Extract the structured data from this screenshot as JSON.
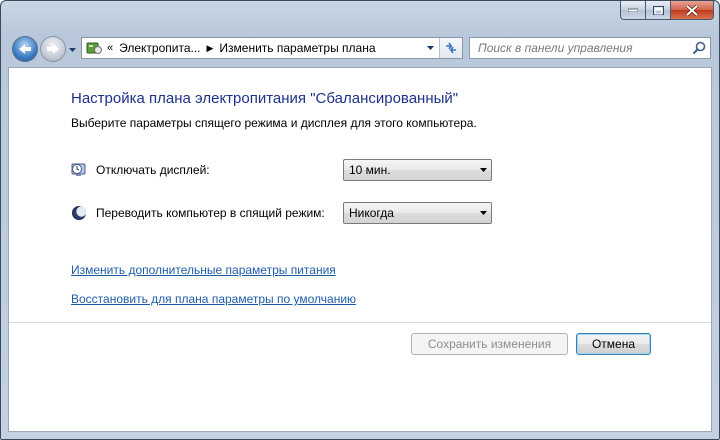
{
  "window": {
    "caption_buttons": {
      "minimize_icon": "minimize-icon",
      "maximize_icon": "maximize-icon",
      "close_icon": "close-icon"
    }
  },
  "nav": {
    "address": {
      "segments": [
        {
          "label": "Электропита..."
        },
        {
          "label": "Изменить параметры плана"
        }
      ],
      "chevron": "«"
    },
    "search": {
      "placeholder": "Поиск в панели управления"
    }
  },
  "main": {
    "title": "Настройка плана электропитания \"Сбалансированный\"",
    "subtitle": "Выберите параметры спящего режима и дисплея для этого компьютера.",
    "settings": [
      {
        "label": "Отключать дисплей:",
        "value": "10 мин.",
        "icon": "display-timer-icon"
      },
      {
        "label": "Переводить компьютер в спящий режим:",
        "value": "Никогда",
        "icon": "sleep-moon-icon"
      }
    ],
    "links": [
      {
        "label": "Изменить дополнительные параметры питания"
      },
      {
        "label": "Восстановить для плана параметры по умолчанию"
      }
    ],
    "buttons": {
      "save_label": "Сохранить изменения",
      "cancel_label": "Отмена"
    }
  },
  "colors": {
    "title": "#1e3287",
    "link": "#1f5ca8",
    "close": "#c0391f"
  }
}
